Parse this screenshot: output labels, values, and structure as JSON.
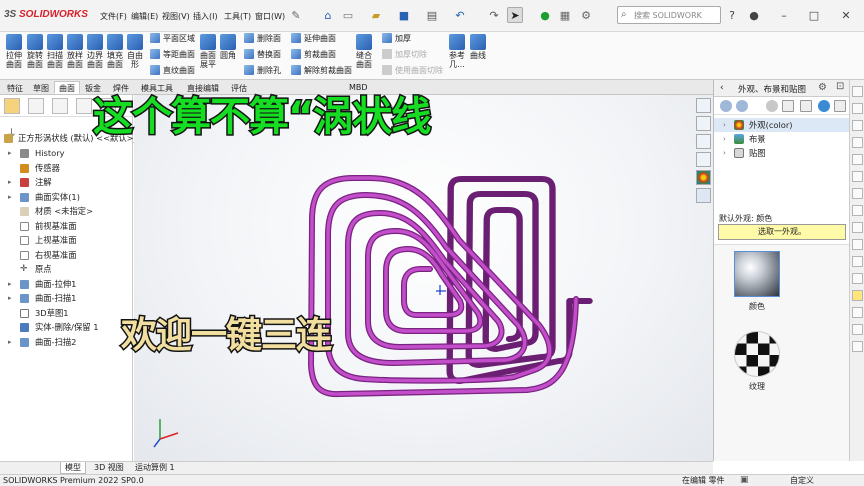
{
  "app": {
    "name": "SOLIDWORKS",
    "logo_prefix": "3S"
  },
  "menu": [
    "文件(F)",
    "编辑(E)",
    "视图(V)",
    "插入(I)",
    "工具(T)",
    "窗口(W)"
  ],
  "search": {
    "placeholder": "搜索 SOLIDWORK"
  },
  "ribbon": {
    "big": [
      "拉伸曲面",
      "旋转曲面",
      "扫描曲面",
      "放样曲面",
      "边界曲面",
      "填充曲面",
      "自由形"
    ],
    "g1": [
      "平面区域",
      "等距曲面",
      "直纹曲面"
    ],
    "g1b": "曲面展平",
    "g2": [
      "删除面",
      "替换面",
      "删除孔"
    ],
    "g2b": "圆角",
    "g3": [
      "延伸曲面",
      "剪裁曲面",
      "解除剪裁曲面"
    ],
    "g4": "缝合曲面",
    "g5": [
      "加厚",
      "加厚切除",
      "使用曲面切除"
    ],
    "g6": [
      "参考几...",
      "曲线"
    ]
  },
  "tabs": [
    "特征",
    "草图",
    "曲面",
    "钣金",
    "焊件",
    "模具工具",
    "直接编辑",
    "评估",
    "MBD"
  ],
  "tree": {
    "root": "正方形涡状线 (默认) <<默认>_",
    "items": [
      "History",
      "传感器",
      "注解",
      "曲面实体(1)",
      "材质 <未指定>",
      "前视基准面",
      "上视基准面",
      "右视基准面",
      "原点",
      "曲面-拉伸1",
      "曲面-扫描1",
      "3D草图1",
      "实体-删除/保留 1",
      "曲面-扫描2"
    ]
  },
  "overlay": {
    "title": "这个算不算“涡状线",
    "subtitle": "欢迎一键三连"
  },
  "taskpane": {
    "title": "外观、布景和贴图",
    "items": [
      "外观(color)",
      "布景",
      "贴图"
    ],
    "default_label": "默认外观: 颜色",
    "hint": "选取一外观。",
    "previews": [
      "颜色",
      "纹理"
    ]
  },
  "bottom_tabs": [
    "模型",
    "3D 视图",
    "运动算例 1"
  ],
  "status": {
    "left": "SOLIDWORKS Premium 2022 SP0.0",
    "mode": "在编辑 零件",
    "custom": "自定义"
  },
  "colors": {
    "spiral": "#b23ab8",
    "overlay_green": "#14dd22",
    "overlay_cream": "#f2dfa0",
    "brand": "#d8202b"
  }
}
